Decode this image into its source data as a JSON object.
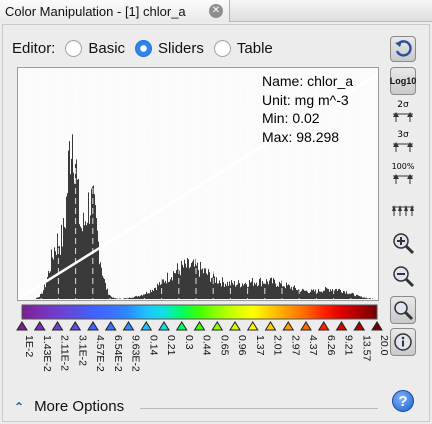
{
  "window": {
    "tab_title": "Color Manipulation - [1] chlor_a"
  },
  "editor": {
    "label": "Editor:",
    "options": [
      "Basic",
      "Sliders",
      "Table"
    ],
    "selected": "Sliders"
  },
  "band_info": {
    "name": "Name: chlor_a",
    "unit": "Unit: mg m^-3",
    "min": "Min: 0.02",
    "max": "Max: 98.298"
  },
  "slider_labels": [
    "1E-2",
    "1.43E-2",
    "2.11E-2",
    "3.1E-2",
    "4.57E-2",
    "6.54E-2",
    "9.63E-2",
    "0.14",
    "0.21",
    "0.3",
    "0.44",
    "0.65",
    "0.96",
    "1.37",
    "2.01",
    "2.97",
    "4.37",
    "6.26",
    "9.21",
    "13.57",
    "20.0"
  ],
  "slider_colors": [
    "#7a1f8f",
    "#7a2fb5",
    "#6f3fd0",
    "#5a4fe0",
    "#4060ff",
    "#3a6fff",
    "#2a8cff",
    "#20c0ff",
    "#10e0e0",
    "#00ff60",
    "#40ff00",
    "#90ff00",
    "#d0ff00",
    "#ffff00",
    "#ffcc00",
    "#ff9900",
    "#ff6600",
    "#ff2200",
    "#dd0000",
    "#aa0000",
    "#700000"
  ],
  "side_buttons": [
    "reset-icon",
    "log10-icon",
    "2-sigma-icon",
    "3-sigma-icon",
    "100-percent-icon",
    "distribute-evenly-icon",
    "zoom-in-icon",
    "zoom-out-icon",
    "zoom-fit-icon",
    "info-icon"
  ],
  "side_text": {
    "log": "Log10",
    "sigma2": "2σ",
    "sigma3": "3σ",
    "pct": "100%"
  },
  "more_options": "More Options",
  "help": "?",
  "chart_data": {
    "type": "bar",
    "title": "",
    "xlabel": "",
    "ylabel": "",
    "x_range": [
      0,
      1
    ],
    "y_range": [
      0,
      1
    ],
    "peaks": [
      {
        "x": 0.15,
        "value": 0.88
      },
      {
        "x": 0.2,
        "value": 0.55
      },
      {
        "x": 0.47,
        "value": 0.18
      }
    ]
  }
}
